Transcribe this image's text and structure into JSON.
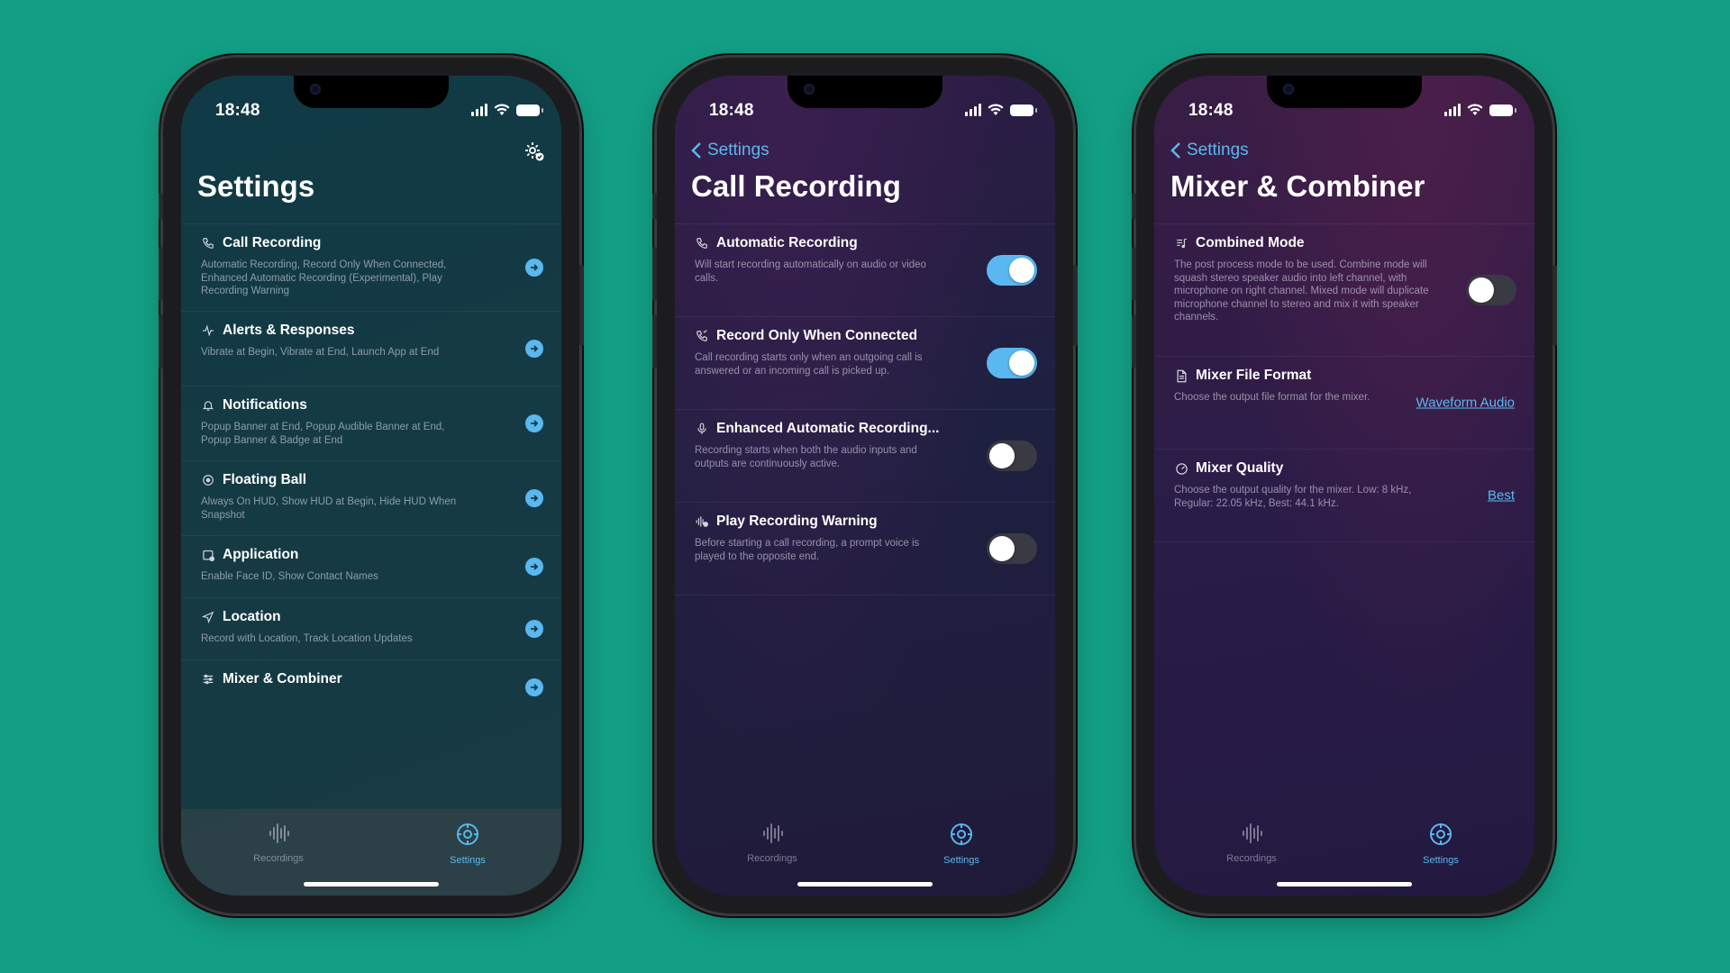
{
  "status": {
    "time": "18:48"
  },
  "phones": [
    {
      "title": "Settings",
      "gear_icon": "gear-check-icon",
      "rows": [
        {
          "icon": "phone-icon",
          "title": "Call Recording",
          "desc": "Automatic Recording, Record Only When Connected, Enhanced Automatic Recording (Experimental), Play Recording Warning"
        },
        {
          "icon": "pulse-icon",
          "title": "Alerts & Responses",
          "desc": "Vibrate at Begin, Vibrate at End, Launch App at End"
        },
        {
          "icon": "bell-icon",
          "title": "Notifications",
          "desc": "Popup Banner at End, Popup Audible Banner at End, Popup Banner & Badge at End"
        },
        {
          "icon": "target-icon",
          "title": "Floating Ball",
          "desc": "Always On HUD, Show HUD at Begin, Hide HUD When Snapshot"
        },
        {
          "icon": "app-window-icon",
          "title": "Application",
          "desc": "Enable Face ID, Show Contact Names"
        },
        {
          "icon": "location-arrow-icon",
          "title": "Location",
          "desc": "Record with Location, Track Location Updates"
        },
        {
          "icon": "sliders-icon",
          "title": "Mixer & Combiner",
          "desc": ""
        }
      ]
    },
    {
      "back_label": "Settings",
      "title": "Call Recording",
      "rows": [
        {
          "icon": "phone-icon",
          "title": "Automatic Recording",
          "desc": "Will start recording automatically on audio or video calls.",
          "toggle": true
        },
        {
          "icon": "phone-connected-icon",
          "title": "Record Only When Connected",
          "desc": "Call recording starts only when an outgoing call is answered or an incoming call is picked up.",
          "toggle": true
        },
        {
          "icon": "microphone-icon",
          "title": "Enhanced Automatic Recording...",
          "desc": "Recording starts when both the audio inputs and outputs are continuously active.",
          "toggle": false
        },
        {
          "icon": "waveform-warning-icon",
          "title": "Play Recording Warning",
          "desc": "Before starting a call recording, a prompt voice is played to the opposite end.",
          "toggle": false
        }
      ]
    },
    {
      "back_label": "Settings",
      "title": "Mixer & Combiner",
      "rows": [
        {
          "icon": "music-list-icon",
          "title": "Combined Mode",
          "desc": "The post process mode to be used. Combine mode will squash stereo speaker audio into left channel, with microphone on right channel. Mixed mode will duplicate microphone channel to stereo and mix it with speaker channels.",
          "toggle": false
        },
        {
          "icon": "document-icon",
          "title": "Mixer File Format",
          "desc": "Choose the output file format for the mixer.",
          "value": "Waveform Audio"
        },
        {
          "icon": "gauge-icon",
          "title": "Mixer Quality",
          "desc": "Choose the output quality for the mixer. Low: 8 kHz, Regular: 22.05 kHz, Best: 44.1 kHz.",
          "value": "Best"
        }
      ]
    }
  ],
  "tabs": {
    "recordings": "Recordings",
    "settings": "Settings"
  },
  "colors": {
    "background": "#139F85",
    "accent": "#5ab8f0"
  }
}
